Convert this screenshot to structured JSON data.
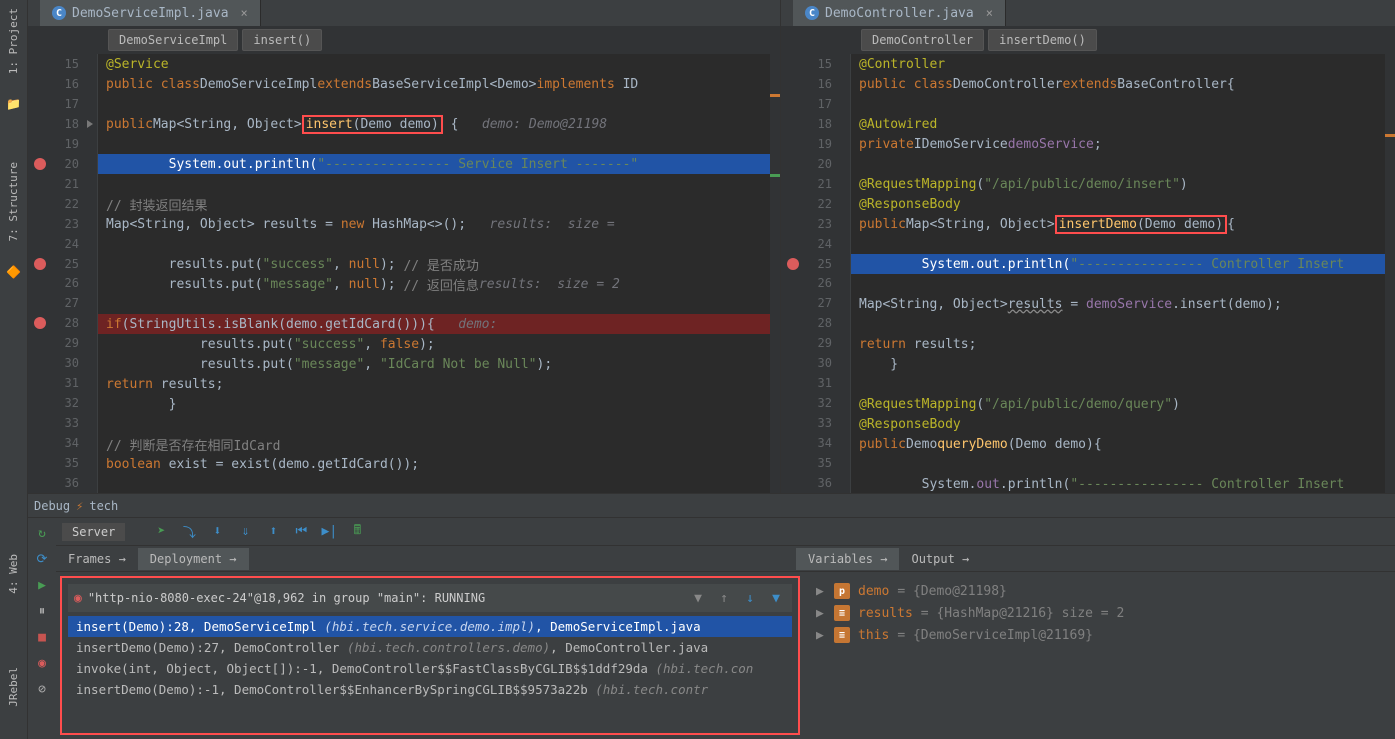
{
  "left_toolbar": {
    "project": "1: Project",
    "structure": "7: Structure"
  },
  "editor_left": {
    "tab": "DemoServiceImpl.java",
    "crumb1": "DemoServiceImpl",
    "crumb2": "insert()",
    "lines": [
      {
        "n": 15,
        "html": "<span class='k-anno'>@Service</span>"
      },
      {
        "n": 16,
        "html": "<span class='k-orange'>public class</span> <span class='k-type'>DemoServiceImpl</span> <span class='k-orange'>extends</span> <span class='k-type'>BaseServiceImpl&lt;Demo&gt;</span> <span class='k-orange'>implements</span> ID"
      },
      {
        "n": 17,
        "html": ""
      },
      {
        "n": 18,
        "html": "    <span class='k-orange'>public</span> <span class='k-type'>Map&lt;String, Object&gt;</span> <span class='redbox'><span class='k-yellow'>insert</span>(Demo <span class='k-type'>demo</span>)</span> {   <span class='k-param'>demo: Demo@21198</span>",
        "arrow": true
      },
      {
        "n": 19,
        "html": ""
      },
      {
        "n": 20,
        "html": "        System.out.println(<span class='k-green'>\"---------------- Service Insert -------\"</span>",
        "bp": true,
        "exec": true
      },
      {
        "n": 21,
        "html": ""
      },
      {
        "n": 22,
        "html": "        <span class='k-gray'>// 封装返回结果</span>"
      },
      {
        "n": 23,
        "html": "        <span class='k-type'>Map&lt;String, Object&gt;</span> results = <span class='k-orange'>new</span> HashMap&lt;&gt;();   <span class='k-param'>results:  size =</span>"
      },
      {
        "n": 24,
        "html": ""
      },
      {
        "n": 25,
        "html": "        results.put(<span class='k-green'>\"success\"</span>, <span class='k-orange'>null</span>); <span class='k-gray'>// 是否成功</span>",
        "bp": true
      },
      {
        "n": 26,
        "html": "        results.put(<span class='k-green'>\"message\"</span>, <span class='k-orange'>null</span>); <span class='k-gray'>// 返回信息</span>   <span class='k-param'>results:  size = 2</span>"
      },
      {
        "n": 27,
        "html": ""
      },
      {
        "n": 28,
        "html": "        <span class='k-orange'>if</span>(StringUtils.isBlank(demo.getIdCard())){   <span class='k-param'>demo:</span>",
        "bp": true,
        "bphit": true
      },
      {
        "n": 29,
        "html": "            results.put(<span class='k-green'>\"success\"</span>, <span class='k-orange'>false</span>);"
      },
      {
        "n": 30,
        "html": "            results.put(<span class='k-green'>\"message\"</span>, <span class='k-green'>\"IdCard Not be Null\"</span>);"
      },
      {
        "n": 31,
        "html": "            <span class='k-orange'>return</span> results;"
      },
      {
        "n": 32,
        "html": "        }"
      },
      {
        "n": 33,
        "html": ""
      },
      {
        "n": 34,
        "html": "        <span class='k-gray'>// 判断是否存在相同IdCard</span>"
      },
      {
        "n": 35,
        "html": "        <span class='k-orange'>boolean</span> exist = exist(demo.getIdCard());"
      },
      {
        "n": 36,
        "html": ""
      }
    ]
  },
  "editor_right": {
    "tab": "DemoController.java",
    "crumb1": "DemoController",
    "crumb2": "insertDemo()",
    "lines": [
      {
        "n": 15,
        "html": "<span class='k-anno'>@Controller</span>"
      },
      {
        "n": 16,
        "html": "<span class='k-orange'>public class</span> <span class='k-type'>DemoController</span> <span class='k-orange'>extends</span> <span class='k-type'>BaseController</span>{"
      },
      {
        "n": 17,
        "html": ""
      },
      {
        "n": 18,
        "html": "    <span class='k-anno'>@Autowired</span>"
      },
      {
        "n": 19,
        "html": "    <span class='k-orange'>private</span> <span class='k-type'>IDemoService</span> <span class='k-purple'>demoService</span>;"
      },
      {
        "n": 20,
        "html": ""
      },
      {
        "n": 21,
        "html": "    <span class='k-anno'>@RequestMapping</span>(<span class='k-green'>\"/api/public/demo/insert\"</span>)"
      },
      {
        "n": 22,
        "html": "    <span class='k-anno'>@ResponseBody</span>"
      },
      {
        "n": 23,
        "html": "    <span class='k-orange'>public</span> <span class='k-type'>Map&lt;String, Object&gt;</span> <span class='redbox'><span class='k-yellow'>insertDemo</span>(Demo <span class='k-type'>demo</span>)</span>{"
      },
      {
        "n": 24,
        "html": ""
      },
      {
        "n": 25,
        "html": "        System.out.println(<span class='k-green'>\"---------------- Controller Insert</span>",
        "bp": true,
        "exec": true
      },
      {
        "n": 26,
        "html": ""
      },
      {
        "n": 27,
        "html": "        <span class='k-type'>Map&lt;String, Object&gt;</span> <span style='text-decoration:underline wavy #888'>results</span> = <span class='k-purple'>demoService</span>.insert(demo);"
      },
      {
        "n": 28,
        "html": ""
      },
      {
        "n": 29,
        "html": "        <span class='k-orange'>return</span> results;"
      },
      {
        "n": 30,
        "html": "    }"
      },
      {
        "n": 31,
        "html": ""
      },
      {
        "n": 32,
        "html": "    <span class='k-anno'>@RequestMapping</span>(<span class='k-green'>\"/api/public/demo/query\"</span>)"
      },
      {
        "n": 33,
        "html": "    <span class='k-anno'>@ResponseBody</span>"
      },
      {
        "n": 34,
        "html": "    <span class='k-orange'>public</span> <span class='k-type'>Demo</span> <span class='k-yellow'>queryDemo</span>(Demo <span class='k-type'>demo</span>){"
      },
      {
        "n": 35,
        "html": ""
      },
      {
        "n": 36,
        "html": "        System.<span class='k-purple'>out</span>.println(<span class='k-green'>\"---------------- Controller Insert</span>"
      }
    ]
  },
  "debug": {
    "title": "Debug",
    "config": "tech",
    "server": "Server",
    "tabs_left": [
      "Frames →",
      "Deployment →"
    ],
    "tabs_right": [
      "Variables →",
      "Output →"
    ],
    "thread": "\"http-nio-8080-exec-24\"@18,962 in group \"main\": RUNNING",
    "frames": [
      {
        "sel": true,
        "m": "insert(Demo):28, DemoServiceImpl ",
        "p": "(hbi.tech.service.demo.impl)",
        "f": ", DemoServiceImpl.java"
      },
      {
        "m": "insertDemo(Demo):27, DemoController ",
        "p": "(hbi.tech.controllers.demo)",
        "f": ", DemoController.java"
      },
      {
        "m": "invoke(int, Object, Object[]):-1, DemoController$$FastClassByCGLIB$$1ddf29da ",
        "p": "(hbi.tech.con",
        "f": ""
      },
      {
        "m": "insertDemo(Demo):-1, DemoController$$EnhancerBySpringCGLIB$$9573a22b ",
        "p": "(hbi.tech.contr",
        "f": ""
      }
    ],
    "vars": [
      {
        "icon": "p",
        "color": "#c57633",
        "name": "demo",
        "val": " = {Demo@21198}"
      },
      {
        "icon": "≡",
        "color": "#c57633",
        "name": "results",
        "val": " = {HashMap@21216}  size = 2"
      },
      {
        "icon": "≡",
        "color": "#c57633",
        "name": "this",
        "val": " = {DemoServiceImpl@21169}"
      }
    ]
  },
  "bottom_tabs": {
    "web": "4: Web",
    "jrebel": "JRebel"
  }
}
